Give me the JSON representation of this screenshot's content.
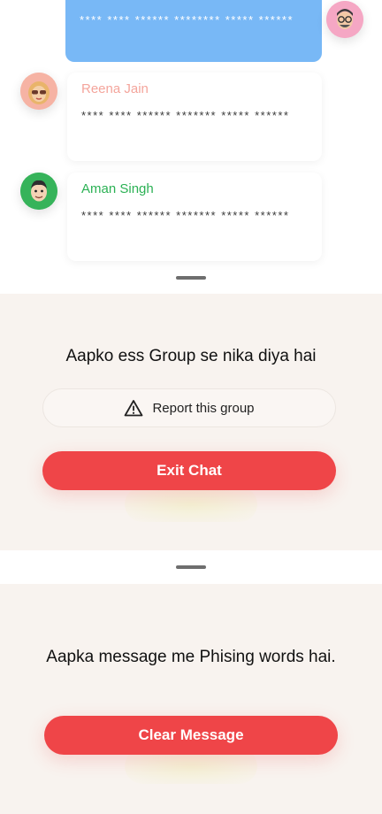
{
  "chat": {
    "own_message": {
      "text": "**** **** ****** ******** ***** ******"
    },
    "messages": [
      {
        "sender": "Reena Jain",
        "sender_color": "#f4a59c",
        "text": "**** **** ****** ******* ***** ******",
        "avatar_icon": "woman-sunglasses-avatar-icon"
      },
      {
        "sender": "Aman Singh",
        "sender_color": "#2bb154",
        "text": "**** **** ****** ******* ***** ******",
        "avatar_icon": "man-avatar-icon"
      }
    ]
  },
  "exit_sheet": {
    "title": "Aapko ess Group se nika diya hai",
    "report_label": "Report this group",
    "report_icon": "warning-triangle-icon",
    "exit_label": "Exit Chat"
  },
  "phishing_sheet": {
    "title": "Aapka message me Phising words hai.",
    "clear_label": "Clear Message"
  },
  "colors": {
    "own_bubble": "#78b8f6",
    "primary_red": "#ef4548",
    "sheet_bg": "#f8f3ef"
  }
}
